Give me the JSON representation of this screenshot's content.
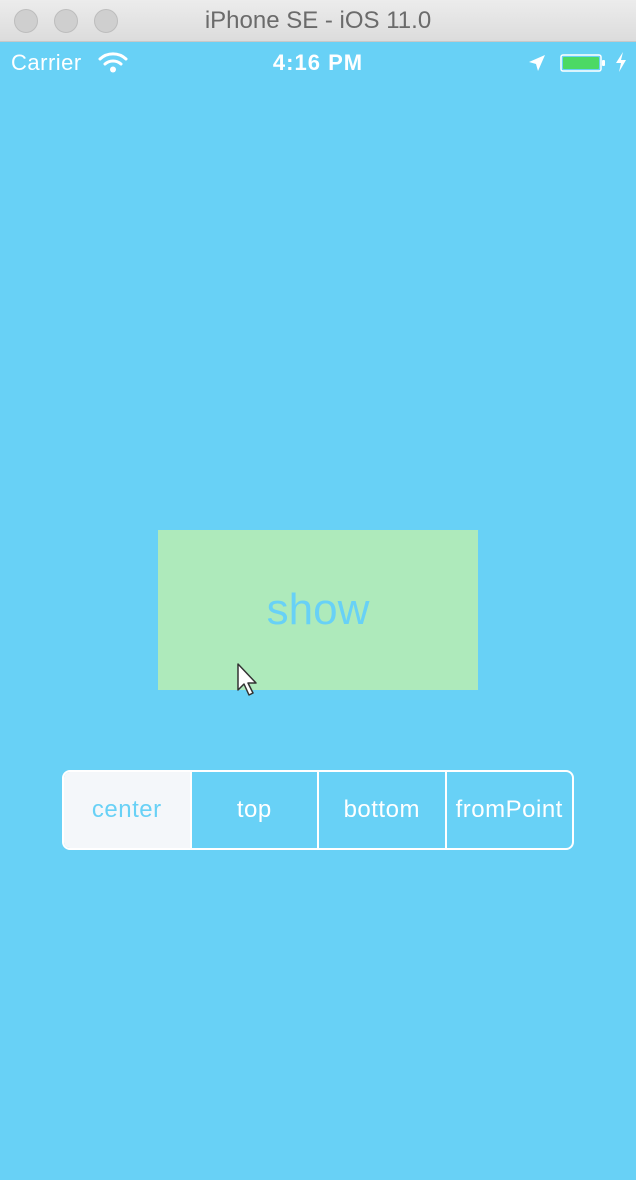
{
  "window": {
    "title": "iPhone SE - iOS 11.0"
  },
  "status_bar": {
    "carrier": "Carrier",
    "time": "4:16 PM",
    "icons": [
      "wifi-icon",
      "location-arrow-icon",
      "battery-icon",
      "charging-bolt-icon"
    ],
    "battery_level": 1.0
  },
  "main": {
    "show_button_label": "show",
    "segments": [
      {
        "label": "center",
        "selected": true
      },
      {
        "label": "top",
        "selected": false
      },
      {
        "label": "bottom",
        "selected": false
      },
      {
        "label": "fromPoint",
        "selected": false
      }
    ]
  },
  "colors": {
    "screen_background": "#68d1f6",
    "show_button_background": "#aeeabb",
    "segment_selected_background": "#f4f7fa",
    "battery_fill": "#4cd964"
  }
}
